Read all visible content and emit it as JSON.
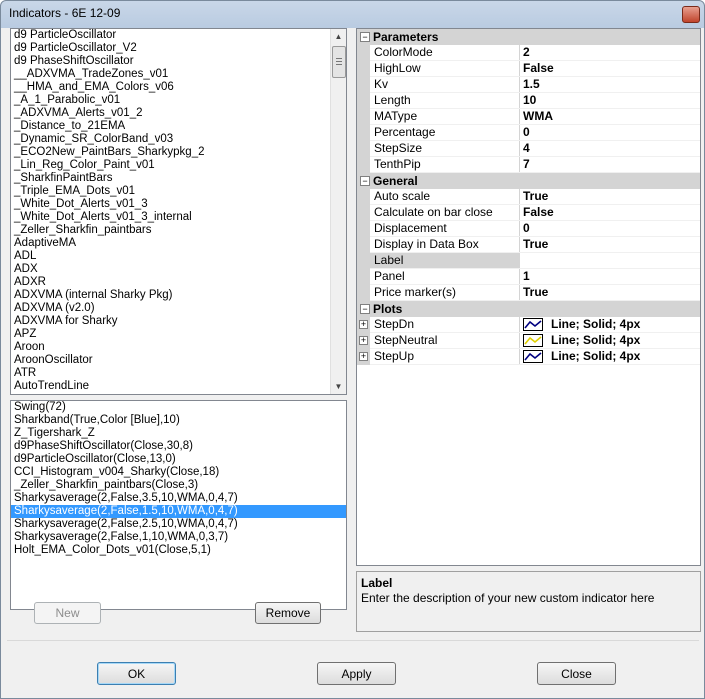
{
  "window": {
    "title": "Indicators - 6E 12-09",
    "close_glyph": "×"
  },
  "available_indicators": [
    "d9 ParticleOscillator",
    "d9 ParticleOscillator_V2",
    "d9 PhaseShiftOscillator",
    "__ADXVMA_TradeZones_v01",
    "__HMA_and_EMA_Colors_v06",
    "_A_1_Parabolic_v01",
    "_ADXVMA_Alerts_v01_2",
    "_Distance_to_21EMA",
    "_Dynamic_SR_ColorBand_v03",
    "_ECO2New_PaintBars_Sharkypkg_2",
    "_Lin_Reg_Color_Paint_v01",
    "_SharkfinPaintBars",
    "_Triple_EMA_Dots_v01",
    "_White_Dot_Alerts_v01_3",
    "_White_Dot_Alerts_v01_3_internal",
    "_Zeller_Sharkfin_paintbars",
    "AdaptiveMA",
    "ADL",
    "ADX",
    "ADXR",
    "ADXVMA (internal Sharky Pkg)",
    "ADXVMA (v2.0)",
    "ADXVMA for Sharky",
    "APZ",
    "Aroon",
    "AroonOscillator",
    "ATR",
    "AutoTrendLine"
  ],
  "applied_indicators": [
    "Swing(72)",
    "Sharkband(True,Color [Blue],10)",
    "Z_Tigershark_Z",
    "d9PhaseShiftOscillator(Close,30,8)",
    "d9ParticleOscillator(Close,13,0)",
    "CCI_Histogram_v004_Sharky(Close,18)",
    "_Zeller_Sharkfin_paintbars(Close,3)",
    "Sharkysaverage(2,False,3.5,10,WMA,0,4,7)",
    "Sharkysaverage(2,False,1.5,10,WMA,0,4,7)",
    "Sharkysaverage(2,False,2.5,10,WMA,0,4,7)",
    "Sharkysaverage(2,False,1,10,WMA,0,3,7)",
    "Holt_EMA_Color_Dots_v01(Close,5,1)"
  ],
  "selected_applied_index": 8,
  "buttons": {
    "new": "New",
    "remove": "Remove",
    "ok": "OK",
    "apply": "Apply",
    "close": "Close"
  },
  "icons": {
    "scroll_up": "▲",
    "scroll_down": "▼",
    "collapse": "−",
    "expand": "+"
  },
  "grid": {
    "categories": [
      {
        "name": "Parameters",
        "rows": [
          {
            "name": "ColorMode",
            "value": "2"
          },
          {
            "name": "HighLow",
            "value": "False"
          },
          {
            "name": "Kv",
            "value": "1.5"
          },
          {
            "name": "Length",
            "value": "10"
          },
          {
            "name": "MAType",
            "value": "WMA"
          },
          {
            "name": "Percentage",
            "value": "0"
          },
          {
            "name": "StepSize",
            "value": "4"
          },
          {
            "name": "TenthPip",
            "value": "7"
          }
        ]
      },
      {
        "name": "General",
        "rows": [
          {
            "name": "Auto scale",
            "value": "True"
          },
          {
            "name": "Calculate on bar close",
            "value": "False"
          },
          {
            "name": "Displacement",
            "value": "0"
          },
          {
            "name": "Display in Data Box",
            "value": "True"
          },
          {
            "name": "Label",
            "value": "",
            "selected": true
          },
          {
            "name": "Panel",
            "value": "1"
          },
          {
            "name": "Price marker(s)",
            "value": "True"
          }
        ]
      },
      {
        "name": "Plots",
        "rows": [
          {
            "name": "StepDn",
            "value": "Line; Solid; 4px",
            "swatch": "#000080",
            "expandable": true
          },
          {
            "name": "StepNeutral",
            "value": "Line; Solid; 4px",
            "swatch": "#e0d000",
            "expandable": true
          },
          {
            "name": "StepUp",
            "value": "Line; Solid; 4px",
            "swatch": "#000080",
            "expandable": true
          }
        ]
      }
    ]
  },
  "description": {
    "title": "Label",
    "text": "Enter the description of your new custom indicator here"
  }
}
